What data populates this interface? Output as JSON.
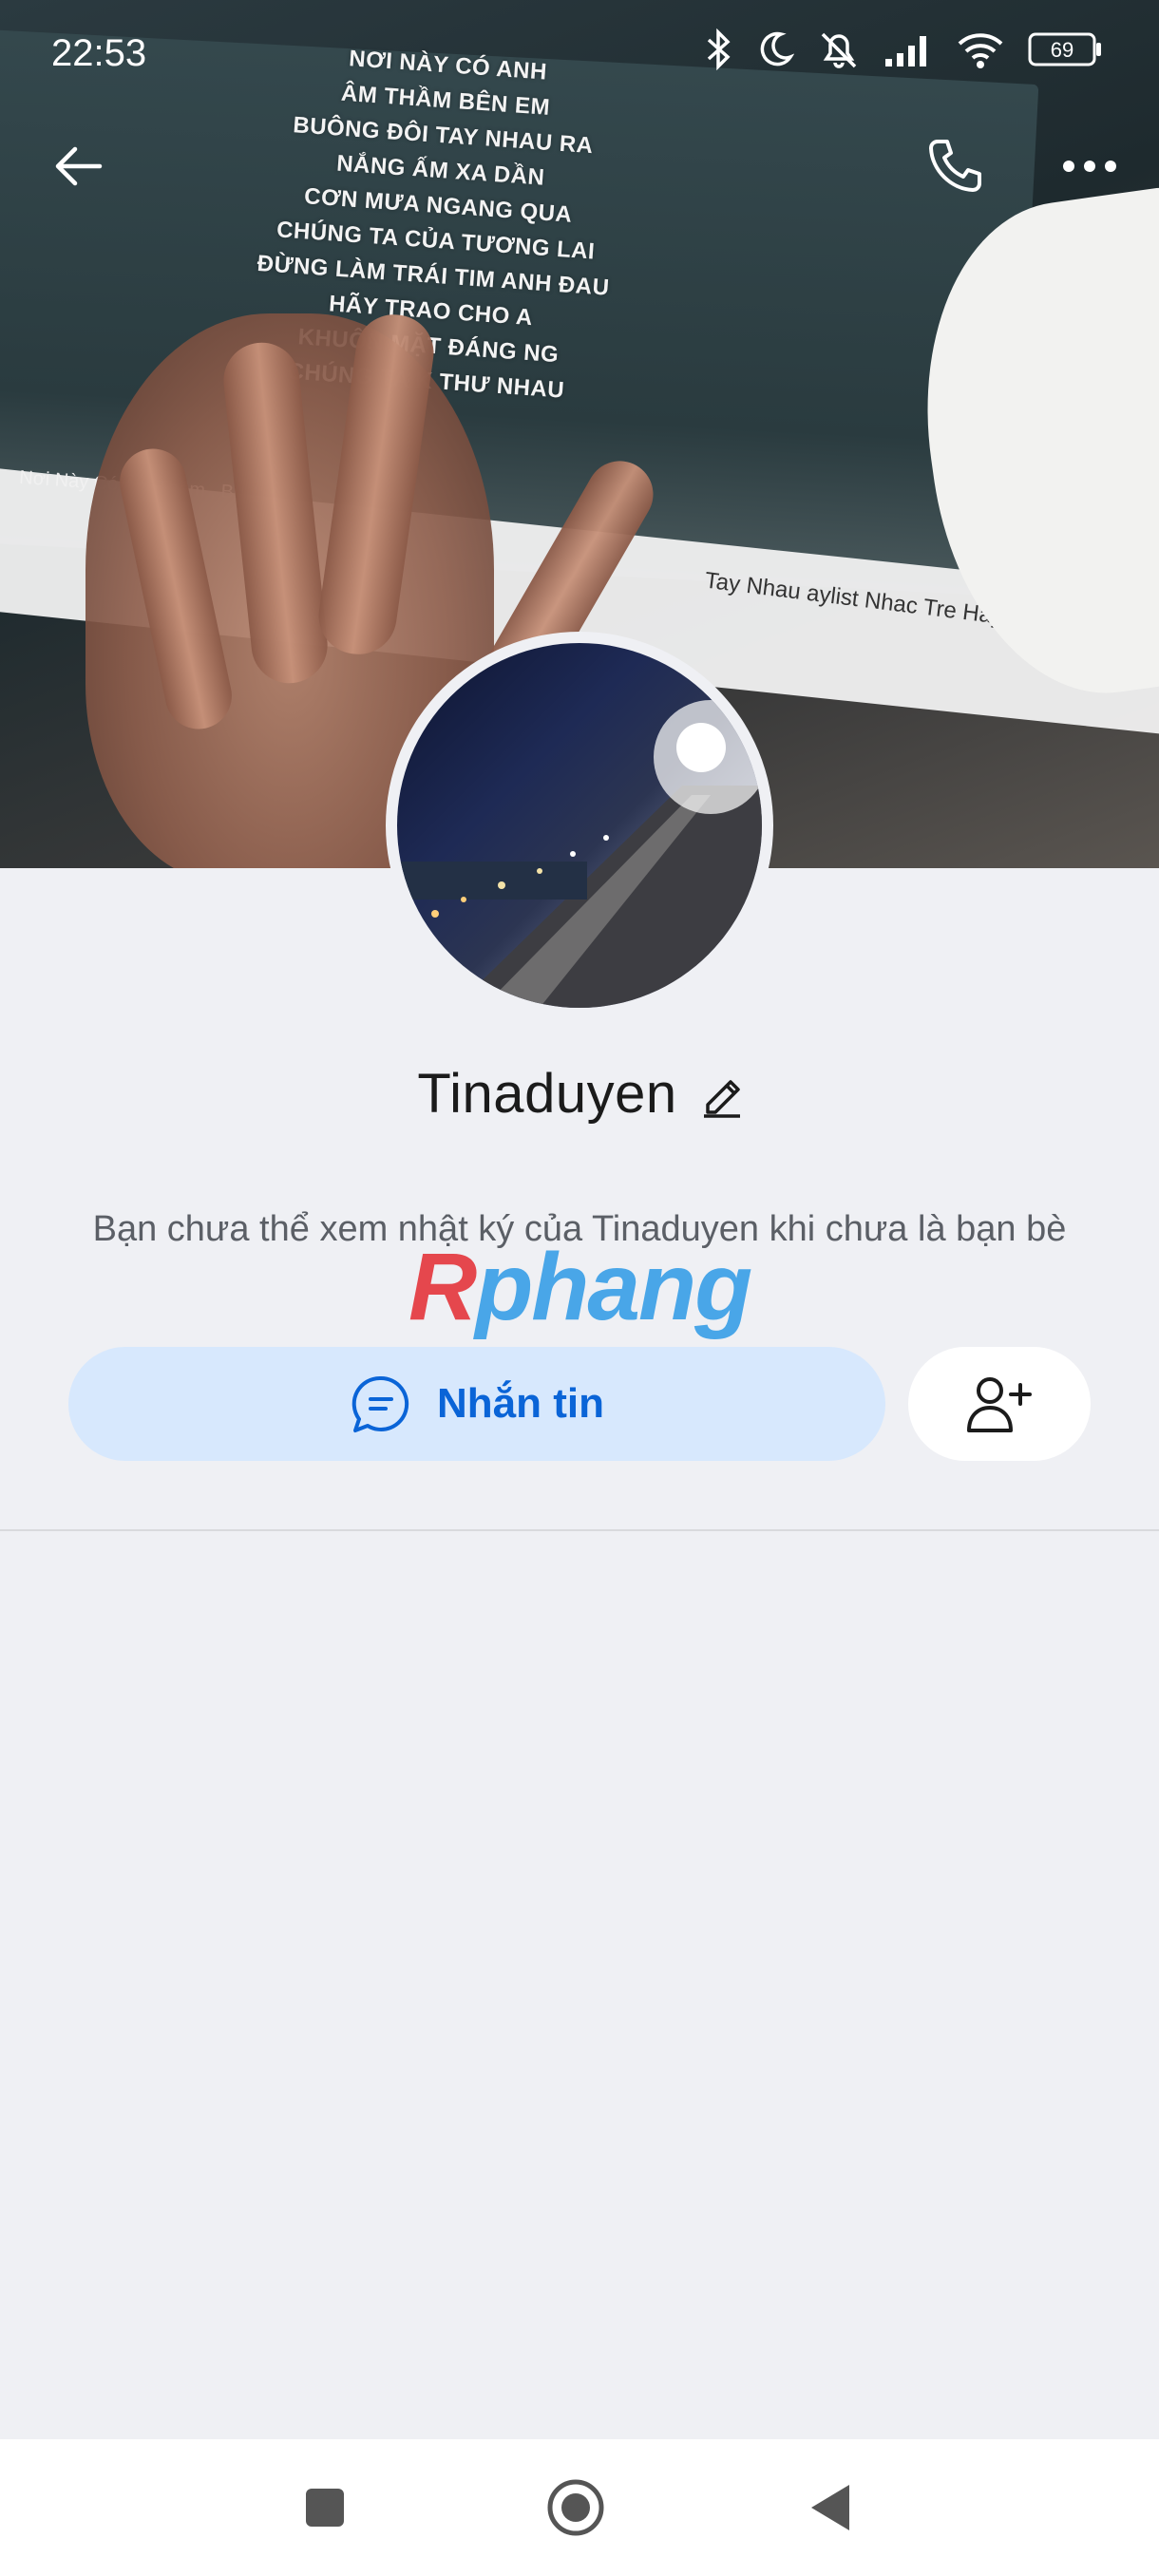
{
  "status_bar": {
    "time": "22:53",
    "battery": "69",
    "signal_note": "6"
  },
  "cover": {
    "lyrics": [
      "NƠI NÀY CÓ ANH",
      "ÂM THẦM BÊN EM",
      "BUÔNG ĐÔI TAY NHAU RA",
      "NẮNG ẤM XA DẦN",
      "CƠN MƯA NGANG QUA",
      "CHÚNG TA CỦA TƯƠNG LAI",
      "ĐỪNG LÀM TRÁI TIM ANH ĐAU",
      "HÃY TRAO CHO A",
      "KHUÔN MẶT ĐÁNG          NG",
      "CHÚNG TA K      THƯ     NHAU"
    ],
    "video_title": "Nơi Này Có           Âm Thầm        , Bu",
    "caption": "Tay Nhau      aylist Nhac Tre Hay Nhat Của Son Tung"
  },
  "profile": {
    "name": "Tinaduyen",
    "notice": "Bạn chưa thể xem nhật ký của Tinaduyen khi chưa là bạn bè",
    "message_label": "Nhắn tin"
  },
  "watermark": {
    "part1": "R",
    "part2": "phang"
  },
  "icons": {
    "back": "arrow-left-icon",
    "call": "phone-icon",
    "more": "more-horizontal-icon",
    "edit": "pencil-icon",
    "message": "chat-bubble-icon",
    "add_friend": "add-user-icon"
  },
  "colors": {
    "accent": "#0a64d7",
    "accent_bg": "#d7e8fd",
    "page_bg": "#eff0f4"
  }
}
